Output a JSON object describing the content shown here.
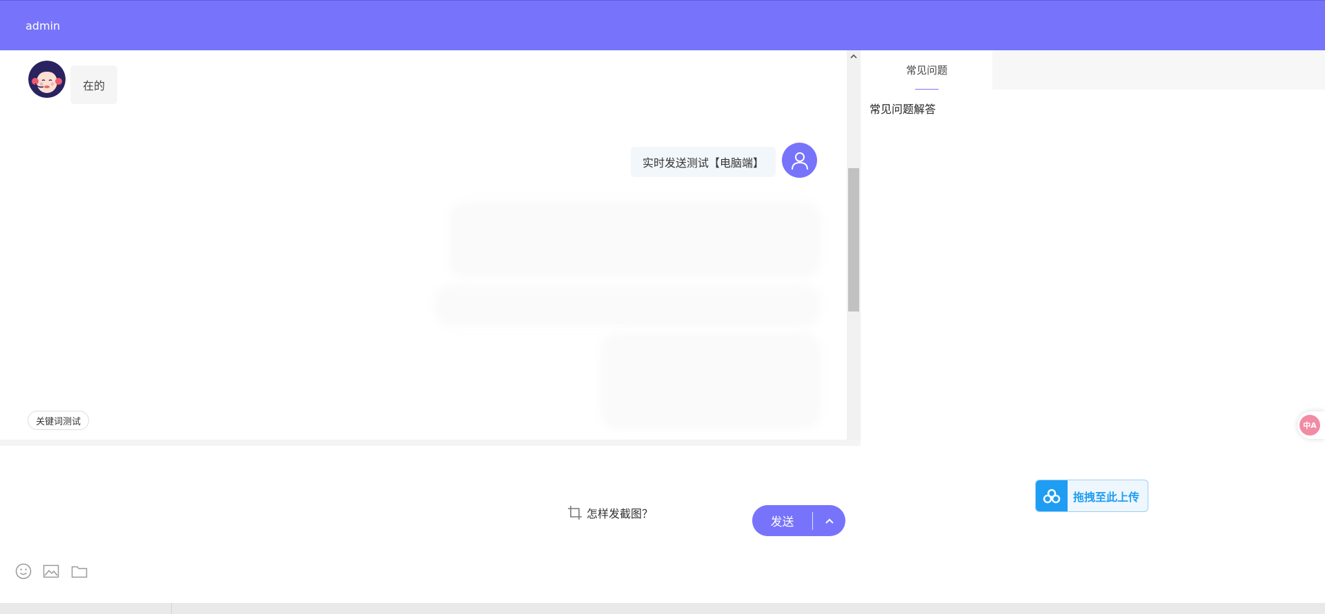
{
  "header": {
    "title": "admin"
  },
  "chat": {
    "messages": [
      {
        "from": "agent",
        "text": "在的"
      },
      {
        "from": "user",
        "text": "实时发送测试【电脑端】"
      }
    ],
    "keyword_chip": "关键词测试"
  },
  "toolbar": {
    "icons": [
      "emoji-icon",
      "image-icon",
      "folder-icon"
    ],
    "screenshot_help": "怎样发截图？",
    "send_label": "发送"
  },
  "side_panel": {
    "tab_label": "常见问题",
    "faq_title": "常见问题解答"
  },
  "overlays": {
    "upload_label": "拖拽至此上传"
  },
  "colors": {
    "accent": "#7774fb",
    "agent_bubble": "#f5f5f5",
    "user_bubble": "#f2f7fc",
    "upload_blue": "#1e9df3"
  }
}
